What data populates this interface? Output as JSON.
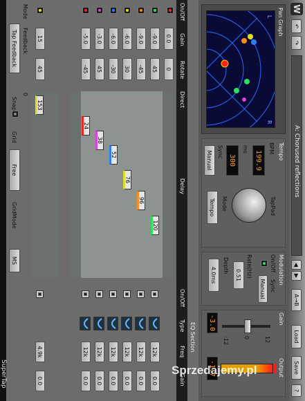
{
  "app_title": "SuperTap",
  "watermark": "Sprzedajemy.pl",
  "preset_name": "A: Chorused reflections",
  "toolbar": {
    "undo": "↶",
    "redo": "↷",
    "ab": "A→B",
    "load": "Load",
    "save": "Save",
    "help": "?"
  },
  "panels": {
    "pan_graph": "Pan Graph",
    "tempo": "Tempo",
    "modulation": "Modulation",
    "gain": "Gain",
    "output": "Output"
  },
  "tempo": {
    "bpm_label": "BPM",
    "bpm": "199.9",
    "ms_label": "ms",
    "ms": "300",
    "sync_label": "Sync",
    "sync": "Manual",
    "mode_label": "Mode",
    "mode": "Tempo",
    "tappad": "TapPad"
  },
  "modulation": {
    "onoff": "On/Off",
    "sync_label": "Sync",
    "sync": "Manual",
    "rate_label": "Rate(Hz)",
    "rate": "0.51",
    "depth_label": "Depth",
    "depth": "4.0ms"
  },
  "gain": {
    "value": "-3.0",
    "scale_low": "-12",
    "scale_mid": "0",
    "scale_high": "12",
    "out_value": "-1.7"
  },
  "headers": {
    "mode": "Mode",
    "feedback": "Feedback",
    "onoff": "On/Off",
    "gain": "Gain",
    "rotate": "Rotate",
    "direct": "Direct",
    "delay": "Delay",
    "eq_section": "EQ Section",
    "eq_onoff": "On/Off",
    "type": "Type",
    "freq": "Freq",
    "eq_gain": "Gain",
    "tap_feedback": "Tap Feedback",
    "snap": "Snap",
    "grid": "Grid",
    "grid_value": "Free",
    "gridmode": "GridMode",
    "gridmode_value": "MS",
    "zero": "0"
  },
  "direct": {
    "gain": "0.0",
    "rotate": "0"
  },
  "feedback": {
    "gain": "15",
    "rotate": "45",
    "delay": "153"
  },
  "taps": [
    {
      "color": "#2fe05a",
      "gain": "-9.0",
      "rotate": "45",
      "delay": "120",
      "freq": "12k",
      "eq_gain": "0.0"
    },
    {
      "color": "#ff8a1e",
      "gain": "-9.0",
      "rotate": "-45",
      "delay": "96",
      "freq": "12k",
      "eq_gain": "0.0"
    },
    {
      "color": "#e0e020",
      "gain": "-6.0",
      "rotate": "30",
      "delay": "76",
      "freq": "12k",
      "eq_gain": "0.0"
    },
    {
      "color": "#2f7dff",
      "gain": "-6.0",
      "rotate": "-30",
      "delay": "52",
      "freq": "12k",
      "eq_gain": "0.0"
    },
    {
      "color": "#e040e0",
      "gain": "-3.0",
      "rotate": "45",
      "delay": "38",
      "freq": "12k",
      "eq_gain": "0.0"
    },
    {
      "color": "#ff2020",
      "gain": "-5.0",
      "rotate": "-45",
      "delay": "24",
      "freq": "12k",
      "eq_gain": "0.0"
    }
  ],
  "feedback_eq": {
    "freq": "4.9k",
    "gain": "0.0"
  }
}
